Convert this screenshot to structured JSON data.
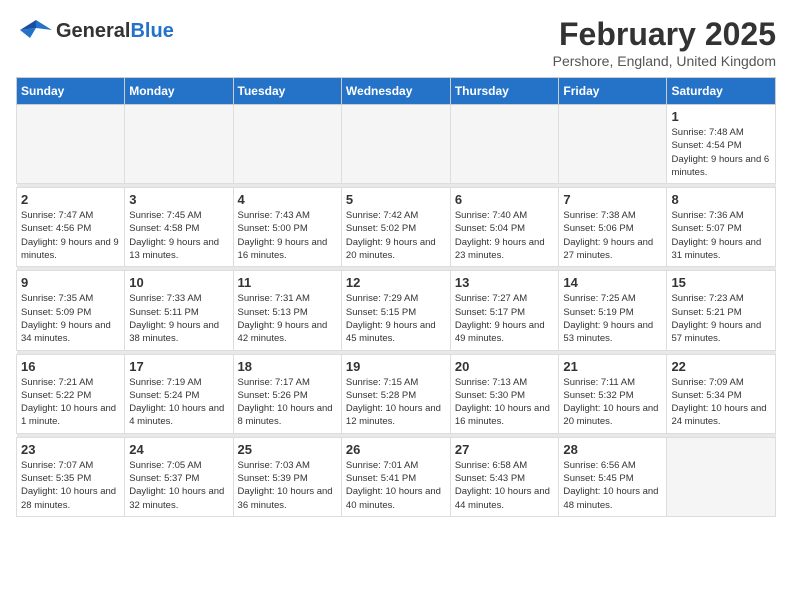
{
  "header": {
    "logo_general": "General",
    "logo_blue": "Blue",
    "month_title": "February 2025",
    "location": "Pershore, England, United Kingdom"
  },
  "days_of_week": [
    "Sunday",
    "Monday",
    "Tuesday",
    "Wednesday",
    "Thursday",
    "Friday",
    "Saturday"
  ],
  "weeks": [
    [
      {
        "day": "",
        "empty": true
      },
      {
        "day": "",
        "empty": true
      },
      {
        "day": "",
        "empty": true
      },
      {
        "day": "",
        "empty": true
      },
      {
        "day": "",
        "empty": true
      },
      {
        "day": "",
        "empty": true
      },
      {
        "day": "1",
        "sunrise": "Sunrise: 7:48 AM",
        "sunset": "Sunset: 4:54 PM",
        "daylight": "Daylight: 9 hours and 6 minutes."
      }
    ],
    [
      {
        "day": "2",
        "sunrise": "Sunrise: 7:47 AM",
        "sunset": "Sunset: 4:56 PM",
        "daylight": "Daylight: 9 hours and 9 minutes."
      },
      {
        "day": "3",
        "sunrise": "Sunrise: 7:45 AM",
        "sunset": "Sunset: 4:58 PM",
        "daylight": "Daylight: 9 hours and 13 minutes."
      },
      {
        "day": "4",
        "sunrise": "Sunrise: 7:43 AM",
        "sunset": "Sunset: 5:00 PM",
        "daylight": "Daylight: 9 hours and 16 minutes."
      },
      {
        "day": "5",
        "sunrise": "Sunrise: 7:42 AM",
        "sunset": "Sunset: 5:02 PM",
        "daylight": "Daylight: 9 hours and 20 minutes."
      },
      {
        "day": "6",
        "sunrise": "Sunrise: 7:40 AM",
        "sunset": "Sunset: 5:04 PM",
        "daylight": "Daylight: 9 hours and 23 minutes."
      },
      {
        "day": "7",
        "sunrise": "Sunrise: 7:38 AM",
        "sunset": "Sunset: 5:06 PM",
        "daylight": "Daylight: 9 hours and 27 minutes."
      },
      {
        "day": "8",
        "sunrise": "Sunrise: 7:36 AM",
        "sunset": "Sunset: 5:07 PM",
        "daylight": "Daylight: 9 hours and 31 minutes."
      }
    ],
    [
      {
        "day": "9",
        "sunrise": "Sunrise: 7:35 AM",
        "sunset": "Sunset: 5:09 PM",
        "daylight": "Daylight: 9 hours and 34 minutes."
      },
      {
        "day": "10",
        "sunrise": "Sunrise: 7:33 AM",
        "sunset": "Sunset: 5:11 PM",
        "daylight": "Daylight: 9 hours and 38 minutes."
      },
      {
        "day": "11",
        "sunrise": "Sunrise: 7:31 AM",
        "sunset": "Sunset: 5:13 PM",
        "daylight": "Daylight: 9 hours and 42 minutes."
      },
      {
        "day": "12",
        "sunrise": "Sunrise: 7:29 AM",
        "sunset": "Sunset: 5:15 PM",
        "daylight": "Daylight: 9 hours and 45 minutes."
      },
      {
        "day": "13",
        "sunrise": "Sunrise: 7:27 AM",
        "sunset": "Sunset: 5:17 PM",
        "daylight": "Daylight: 9 hours and 49 minutes."
      },
      {
        "day": "14",
        "sunrise": "Sunrise: 7:25 AM",
        "sunset": "Sunset: 5:19 PM",
        "daylight": "Daylight: 9 hours and 53 minutes."
      },
      {
        "day": "15",
        "sunrise": "Sunrise: 7:23 AM",
        "sunset": "Sunset: 5:21 PM",
        "daylight": "Daylight: 9 hours and 57 minutes."
      }
    ],
    [
      {
        "day": "16",
        "sunrise": "Sunrise: 7:21 AM",
        "sunset": "Sunset: 5:22 PM",
        "daylight": "Daylight: 10 hours and 1 minute."
      },
      {
        "day": "17",
        "sunrise": "Sunrise: 7:19 AM",
        "sunset": "Sunset: 5:24 PM",
        "daylight": "Daylight: 10 hours and 4 minutes."
      },
      {
        "day": "18",
        "sunrise": "Sunrise: 7:17 AM",
        "sunset": "Sunset: 5:26 PM",
        "daylight": "Daylight: 10 hours and 8 minutes."
      },
      {
        "day": "19",
        "sunrise": "Sunrise: 7:15 AM",
        "sunset": "Sunset: 5:28 PM",
        "daylight": "Daylight: 10 hours and 12 minutes."
      },
      {
        "day": "20",
        "sunrise": "Sunrise: 7:13 AM",
        "sunset": "Sunset: 5:30 PM",
        "daylight": "Daylight: 10 hours and 16 minutes."
      },
      {
        "day": "21",
        "sunrise": "Sunrise: 7:11 AM",
        "sunset": "Sunset: 5:32 PM",
        "daylight": "Daylight: 10 hours and 20 minutes."
      },
      {
        "day": "22",
        "sunrise": "Sunrise: 7:09 AM",
        "sunset": "Sunset: 5:34 PM",
        "daylight": "Daylight: 10 hours and 24 minutes."
      }
    ],
    [
      {
        "day": "23",
        "sunrise": "Sunrise: 7:07 AM",
        "sunset": "Sunset: 5:35 PM",
        "daylight": "Daylight: 10 hours and 28 minutes."
      },
      {
        "day": "24",
        "sunrise": "Sunrise: 7:05 AM",
        "sunset": "Sunset: 5:37 PM",
        "daylight": "Daylight: 10 hours and 32 minutes."
      },
      {
        "day": "25",
        "sunrise": "Sunrise: 7:03 AM",
        "sunset": "Sunset: 5:39 PM",
        "daylight": "Daylight: 10 hours and 36 minutes."
      },
      {
        "day": "26",
        "sunrise": "Sunrise: 7:01 AM",
        "sunset": "Sunset: 5:41 PM",
        "daylight": "Daylight: 10 hours and 40 minutes."
      },
      {
        "day": "27",
        "sunrise": "Sunrise: 6:58 AM",
        "sunset": "Sunset: 5:43 PM",
        "daylight": "Daylight: 10 hours and 44 minutes."
      },
      {
        "day": "28",
        "sunrise": "Sunrise: 6:56 AM",
        "sunset": "Sunset: 5:45 PM",
        "daylight": "Daylight: 10 hours and 48 minutes."
      },
      {
        "day": "",
        "empty": true
      }
    ]
  ]
}
